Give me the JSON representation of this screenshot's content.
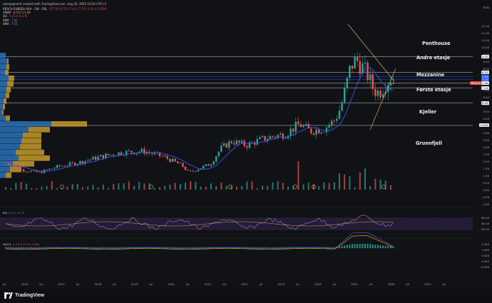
{
  "header": {
    "caption": "swespigment created with TradingView.com, Aug 26, 2025 10:02 UTC+2"
  },
  "legend": {
    "symbol": "REACH SUBSEA ASA · 1W · OSL",
    "ohlc": "O7.50 H7.55 L7.42 C7.50 -0.40 (-5.06%)",
    "vwap_label": "VWAP",
    "vwap_values": "8.014 13.88",
    "vol_label": "Vol",
    "vol_values": "5.25 K 6.2 M",
    "sma1_label": "SMA",
    "sma1_value": "7.84",
    "sma2_label": "SMA",
    "sma2_value": "7.55"
  },
  "price_axis": {
    "currency": "NOK",
    "ticks": [
      "11.50",
      "11.00",
      "10.50",
      "10.00",
      "9.50",
      "9.00",
      "8.50",
      "8.00",
      "7.50",
      "7.00",
      "6.50",
      "6.00",
      "5.50",
      "5.00",
      "4.50",
      "4.00",
      "3.50",
      "3.00",
      "2.50",
      "2.00",
      "1.50",
      "1.00",
      "0.50",
      "0.00",
      "-0.50",
      "-1.00"
    ],
    "tags": [
      {
        "text": "9.33",
        "color": "#f2f2f2"
      },
      {
        "text": "8.22",
        "color": "#f2f2f2"
      },
      {
        "text": "7.94",
        "color": "#2962ff"
      },
      {
        "text": "7.74",
        "color": "#2962ff"
      },
      {
        "text": "7.48",
        "color": "#f2f2f2"
      },
      {
        "text": "REACH",
        "color": "#e0474c"
      },
      {
        "text": "7.14",
        "color": "#f2f2f2"
      },
      {
        "text": "6.09",
        "color": "#f2f2f2"
      },
      {
        "text": "4.505",
        "color": "#f2f2f2"
      }
    ]
  },
  "zones": {
    "penthouse": "Penthouse",
    "andre": "Andre etasje",
    "mezz": "Mezzanine",
    "forste": "Første etasje",
    "kjeller": "Kjeller",
    "grunnfjell": "Grunnfjell"
  },
  "rsi": {
    "label": "RSI",
    "values": "35.94 42.79",
    "ticks": [
      "80.00",
      "60.00",
      "40.00"
    ]
  },
  "macd": {
    "label": "MACD",
    "values": "-0.1529 0.712 0.864",
    "ticks": [
      "1.500",
      "1.000",
      "0.500",
      "0.000",
      "-0.500"
    ]
  },
  "time_axis": {
    "labels": [
      "Jul",
      "2016",
      "Jul",
      "2017",
      "Jul",
      "2018",
      "Jul",
      "2019",
      "Jul",
      "2020",
      "Jul",
      "2021",
      "Jul",
      "2022",
      "Jul",
      "2023",
      "Jul",
      "2024",
      "Jul",
      "2025",
      "Jul",
      "2026",
      "Jul",
      "2027",
      "Jul"
    ]
  },
  "footer": {
    "brand": "TradingView"
  },
  "colors": {
    "up": "#26a69a",
    "down": "#ef5350",
    "ma": "#3f51ff",
    "rsi": "#a17adb",
    "macd": "#2962ff",
    "signal": "#ff9800",
    "vp_blue": "#2a71b8",
    "vp_gold": "#c49a2c"
  }
}
